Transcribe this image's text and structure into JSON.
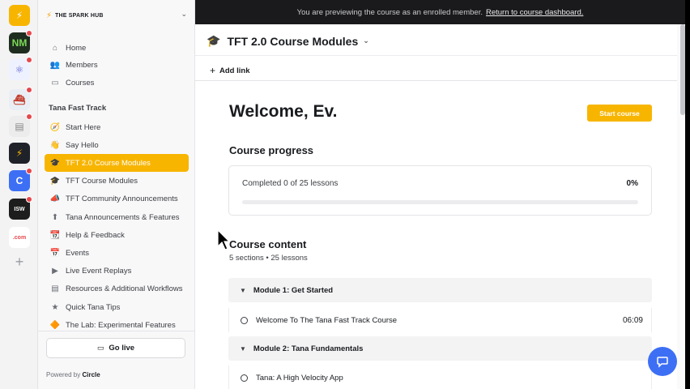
{
  "rail": {
    "items": [
      {
        "name": "spark-hub",
        "text": "⚡",
        "bg": "#f7b500",
        "color": "#ffffff",
        "dot": false
      },
      {
        "name": "nm-community",
        "text": "NM",
        "bg": "#1f2d1f",
        "color": "#7cd957",
        "dot": true
      },
      {
        "name": "react-community",
        "text": "⚛",
        "bg": "#eef1ff",
        "color": "#5a5fcf",
        "dot": true
      },
      {
        "name": "ship-community",
        "text": "⛴",
        "bg": "#e9eef4",
        "color": "#c23b2b",
        "dot": true
      },
      {
        "name": "doc-community",
        "text": "▤",
        "bg": "#ececec",
        "color": "#888888",
        "dot": true
      },
      {
        "name": "bolt-community",
        "text": "⚡",
        "bg": "#20222a",
        "color": "#f7b500",
        "dot": false
      },
      {
        "name": "c-community",
        "text": "C",
        "bg": "#3d6ff5",
        "color": "#ffffff",
        "dot": true
      },
      {
        "name": "isw-community",
        "text": "ISW",
        "bg": "#1d1d1d",
        "color": "#ffffff",
        "dot": true
      },
      {
        "name": "com-community",
        "text": ".com",
        "bg": "#ffffff",
        "color": "#e5484d",
        "dot": false
      }
    ],
    "add_label": "+"
  },
  "sidebar": {
    "brand": "THE SPARK HUB",
    "top_nav": [
      {
        "icon": "⌂",
        "label": "Home"
      },
      {
        "icon": "👥",
        "label": "Members"
      },
      {
        "icon": "▭",
        "label": "Courses"
      }
    ],
    "section": "Tana Fast Track",
    "spaces": [
      {
        "icon": "🧭",
        "label": "Start Here",
        "active": false
      },
      {
        "icon": "👋",
        "label": "Say Hello",
        "active": false
      },
      {
        "icon": "🎓",
        "label": "TFT 2.0 Course Modules",
        "active": true
      },
      {
        "icon": "🎓",
        "label": "TFT Course Modules",
        "active": false
      },
      {
        "icon": "📣",
        "label": "TFT Community Announcements",
        "active": false
      },
      {
        "icon": "⬆",
        "label": "Tana Announcements & Features",
        "active": false
      },
      {
        "icon": "📆",
        "label": "Help & Feedback",
        "active": false
      },
      {
        "icon": "📅",
        "label": "Events",
        "active": false
      },
      {
        "icon": "▶",
        "label": "Live Event Replays",
        "active": false
      },
      {
        "icon": "▤",
        "label": "Resources & Additional Workflows",
        "active": false
      },
      {
        "icon": "★",
        "label": "Quick Tana Tips",
        "active": false
      },
      {
        "icon": "🔶",
        "label": "The Lab: Experimental Features",
        "active": false
      }
    ],
    "go_live": "Go live",
    "powered_prefix": "Powered by",
    "powered_brand": "Circle"
  },
  "banner": {
    "text": "You are previewing the course as an enrolled member.",
    "link": "Return to course dashboard."
  },
  "header": {
    "title": "TFT 2.0 Course Modules",
    "add_link": "Add link"
  },
  "main": {
    "welcome": "Welcome, Ev.",
    "start_button": "Start course",
    "progress_title": "Course progress",
    "progress_text": "Completed 0 of 25 lessons",
    "progress_pct": "0%",
    "progress_value": 0,
    "content_title": "Course content",
    "content_sub": "5 sections • 25 lessons",
    "rows": [
      {
        "type": "module",
        "label": "Module 1: Get Started"
      },
      {
        "type": "lesson",
        "label": "Welcome To The Tana Fast Track Course",
        "duration": "06:09"
      },
      {
        "type": "module",
        "label": "Module 2: Tana Fundamentals"
      },
      {
        "type": "lesson",
        "label": "Tana: A High Velocity App",
        "duration": ""
      }
    ]
  },
  "colors": {
    "accent": "#f7b500",
    "chat": "#3d6ff5"
  }
}
